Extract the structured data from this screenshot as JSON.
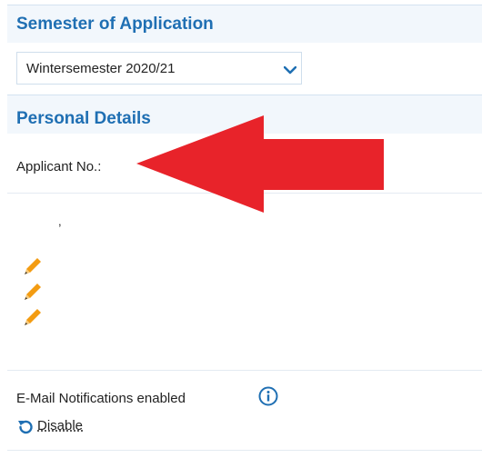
{
  "semester": {
    "title": "Semester of Application",
    "selected_value": "Wintersemester 2020/21"
  },
  "personal": {
    "title": "Personal Details",
    "applicant_label": "Applicant No.:",
    "stray_text": ","
  },
  "notifications": {
    "label": "E-Mail Notifications enabled",
    "disable_label": "Disable"
  },
  "colors": {
    "heading": "#1f6fb3",
    "section_bg": "#f2f7fc",
    "pencil": "#f39c12",
    "annotation_arrow": "#e8232a",
    "icon_blue": "#1f6fb3"
  },
  "icons": [
    "chevron-down-icon",
    "pencil-icon",
    "info-icon",
    "refresh-icon",
    "annotation-arrow"
  ]
}
